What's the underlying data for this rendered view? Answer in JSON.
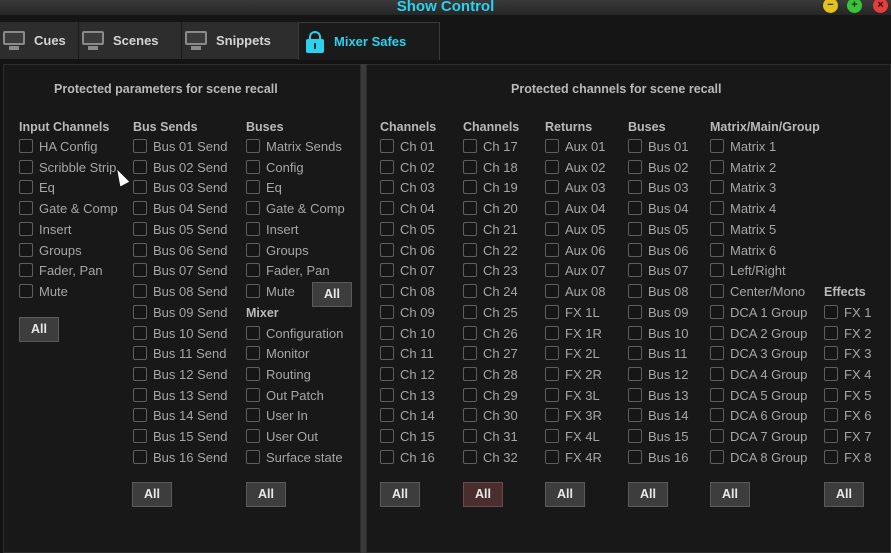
{
  "window": {
    "title": "Show Control"
  },
  "tabs": [
    {
      "label": "Cues",
      "icon": "monitor-icon"
    },
    {
      "label": "Scenes",
      "icon": "monitor-icon"
    },
    {
      "label": "Snippets",
      "icon": "monitor-icon"
    },
    {
      "label": "Mixer Safes",
      "icon": "lock-icon"
    }
  ],
  "accent_color": "#2ad2ee",
  "left_panel": {
    "title": "Protected parameters for scene recall",
    "input_channels": {
      "heading": "Input Channels",
      "items": [
        "HA Config",
        "Scribble Strip",
        "Eq",
        "Gate & Comp",
        "Insert",
        "Groups",
        "Fader, Pan",
        "Mute"
      ]
    },
    "bus_sends": {
      "heading": "Bus Sends",
      "items": [
        "Bus 01 Send",
        "Bus 02 Send",
        "Bus 03 Send",
        "Bus 04 Send",
        "Bus 05 Send",
        "Bus 06 Send",
        "Bus 07 Send",
        "Bus 08 Send",
        "Bus 09 Send",
        "Bus 10 Send",
        "Bus 11 Send",
        "Bus 12 Send",
        "Bus 13 Send",
        "Bus 14 Send",
        "Bus 15 Send",
        "Bus 16 Send"
      ]
    },
    "buses": {
      "heading": "Buses",
      "items": [
        "Matrix Sends",
        "Config",
        "Eq",
        "Gate & Comp",
        "Insert",
        "Groups",
        "Fader, Pan",
        "Mute"
      ]
    },
    "mixer": {
      "heading": "Mixer",
      "items": [
        "Configuration",
        "Monitor",
        "Routing",
        "Out Patch",
        "User In",
        "User Out",
        "Surface state"
      ]
    },
    "all_label": "All"
  },
  "right_panel": {
    "title": "Protected channels for scene recall",
    "channels_a": {
      "heading": "Channels",
      "items": [
        "Ch 01",
        "Ch 02",
        "Ch 03",
        "Ch 04",
        "Ch 05",
        "Ch 06",
        "Ch 07",
        "Ch 08",
        "Ch 09",
        "Ch 10",
        "Ch 11",
        "Ch 12",
        "Ch 13",
        "Ch 14",
        "Ch 15",
        "Ch 16"
      ]
    },
    "channels_b": {
      "heading": "Channels",
      "items": [
        "Ch 17",
        "Ch 18",
        "Ch 19",
        "Ch 20",
        "Ch 21",
        "Ch 22",
        "Ch 23",
        "Ch 24",
        "Ch 25",
        "Ch 26",
        "Ch 27",
        "Ch 28",
        "Ch 29",
        "Ch 30",
        "Ch 31",
        "Ch 32"
      ]
    },
    "returns": {
      "heading": "Returns",
      "items": [
        "Aux 01",
        "Aux 02",
        "Aux 03",
        "Aux 04",
        "Aux 05",
        "Aux 06",
        "Aux 07",
        "Aux 08",
        "FX 1L",
        "FX 1R",
        "FX 2L",
        "FX 2R",
        "FX 3L",
        "FX 3R",
        "FX 4L",
        "FX 4R"
      ]
    },
    "buses": {
      "heading": "Buses",
      "items": [
        "Bus 01",
        "Bus 02",
        "Bus 03",
        "Bus 04",
        "Bus 05",
        "Bus 06",
        "Bus 07",
        "Bus 08",
        "Bus 09",
        "Bus 10",
        "Bus 11",
        "Bus 12",
        "Bus 13",
        "Bus 14",
        "Bus 15",
        "Bus 16"
      ]
    },
    "matrix": {
      "heading": "Matrix/Main/Group",
      "items": [
        "Matrix 1",
        "Matrix 2",
        "Matrix 3",
        "Matrix 4",
        "Matrix 5",
        "Matrix 6",
        "Left/Right",
        "Center/Mono",
        "DCA 1 Group",
        "DCA 2 Group",
        "DCA 3 Group",
        "DCA 4 Group",
        "DCA 5 Group",
        "DCA 6 Group",
        "DCA 7 Group",
        "DCA 8 Group"
      ]
    },
    "effects": {
      "heading": "Effects",
      "items": [
        "FX 1",
        "FX 2",
        "FX 3",
        "FX 4",
        "FX 5",
        "FX 6",
        "FX 7",
        "FX 8"
      ]
    },
    "all_label": "All"
  }
}
